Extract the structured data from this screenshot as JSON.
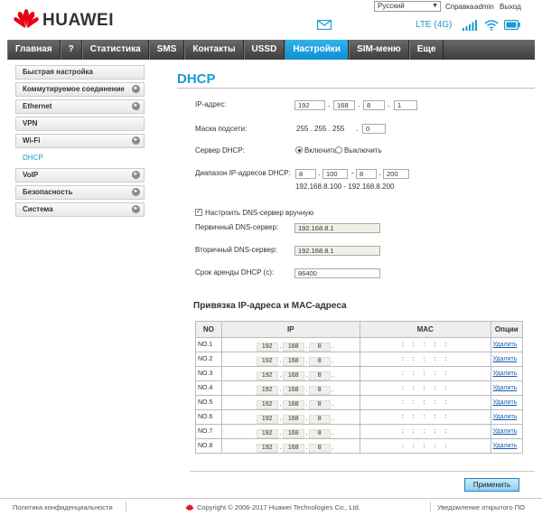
{
  "brand": {
    "name": "HUAWEI"
  },
  "header": {
    "language": "Русский",
    "links": [
      "Справка",
      "admin",
      "Выход"
    ],
    "network": "LTE (4G)"
  },
  "nav": [
    "Главная",
    "?",
    "Статистика",
    "SMS",
    "Контакты",
    "USSD",
    "Настройки",
    "SIM-меню",
    "Еще"
  ],
  "sidebar": [
    {
      "label": "Быстрая настройка",
      "arrow": false
    },
    {
      "label": "Коммутируемое соединение",
      "arrow": true
    },
    {
      "label": "Ethernet",
      "arrow": true
    },
    {
      "label": "VPN",
      "arrow": false
    },
    {
      "label": "Wi-Fi",
      "arrow": true
    },
    {
      "label": "DHCP",
      "arrow": false
    },
    {
      "label": "VoIP",
      "arrow": true
    },
    {
      "label": "Безопасность",
      "arrow": true
    },
    {
      "label": "Система",
      "arrow": true
    }
  ],
  "page": {
    "title": "DHCP",
    "ip_label": "IP-адрес:",
    "ip": [
      "192",
      "168",
      "8",
      "1"
    ],
    "mask_label": "Маска подсети:",
    "mask_prefix": "255 . 255 . 255",
    "mask_last": "0",
    "dhcp_server_label": "Сервер DHCP:",
    "dhcp_on": "Включить",
    "dhcp_off": "Выключить",
    "range_label": "Диапазон IP-адресов DHCP:",
    "range_start": "100",
    "range_end": "200",
    "range_first_octet": "8",
    "range_summary": "192.168.8.100 - 192.168.8.200",
    "dns_manual_label": "Настроить DNS-сервер вручную",
    "dns1_label": "Первичный DNS-сервер:",
    "dns1": "192.168.8.1",
    "dns2_label": "Вторичный DNS-сервер:",
    "dns2": "192.168.8.1",
    "lease_label": "Срок аренды DHCP (с):",
    "lease": "86400",
    "binding_title": "Привязка IP-адреса и MAC-адреса",
    "apply": "Применить"
  },
  "table": {
    "headers": [
      "NO",
      "IP",
      "MAC",
      "Опции"
    ],
    "rows": [
      {
        "no": "NO.1",
        "ip": [
          "192",
          "168",
          "8"
        ],
        "action": "Удалить"
      },
      {
        "no": "NO.2",
        "ip": [
          "192",
          "168",
          "8"
        ],
        "action": "Удалить"
      },
      {
        "no": "NO.3",
        "ip": [
          "192",
          "168",
          "8"
        ],
        "action": "Удалить"
      },
      {
        "no": "NO.4",
        "ip": [
          "192",
          "168",
          "8"
        ],
        "action": "Удалить"
      },
      {
        "no": "NO.5",
        "ip": [
          "192",
          "168",
          "8"
        ],
        "action": "Удалить"
      },
      {
        "no": "NO.6",
        "ip": [
          "192",
          "168",
          "8"
        ],
        "action": "Удалить"
      },
      {
        "no": "NO.7",
        "ip": [
          "192",
          "168",
          "8"
        ],
        "action": "Удалить"
      },
      {
        "no": "NO.8",
        "ip": [
          "192",
          "168",
          "8"
        ],
        "action": "Удалить"
      }
    ]
  },
  "footer": {
    "privacy": "Политика конфиденциальности",
    "copyright": "Copyright © 2006-2017 Huawei Technologies Co., Ltd.",
    "opensource": "Уведомление открытого ПО"
  },
  "colors": {
    "accent": "#1a9ad6",
    "nav_bg": "#4a4a4a",
    "brand_red": "#e60012"
  }
}
